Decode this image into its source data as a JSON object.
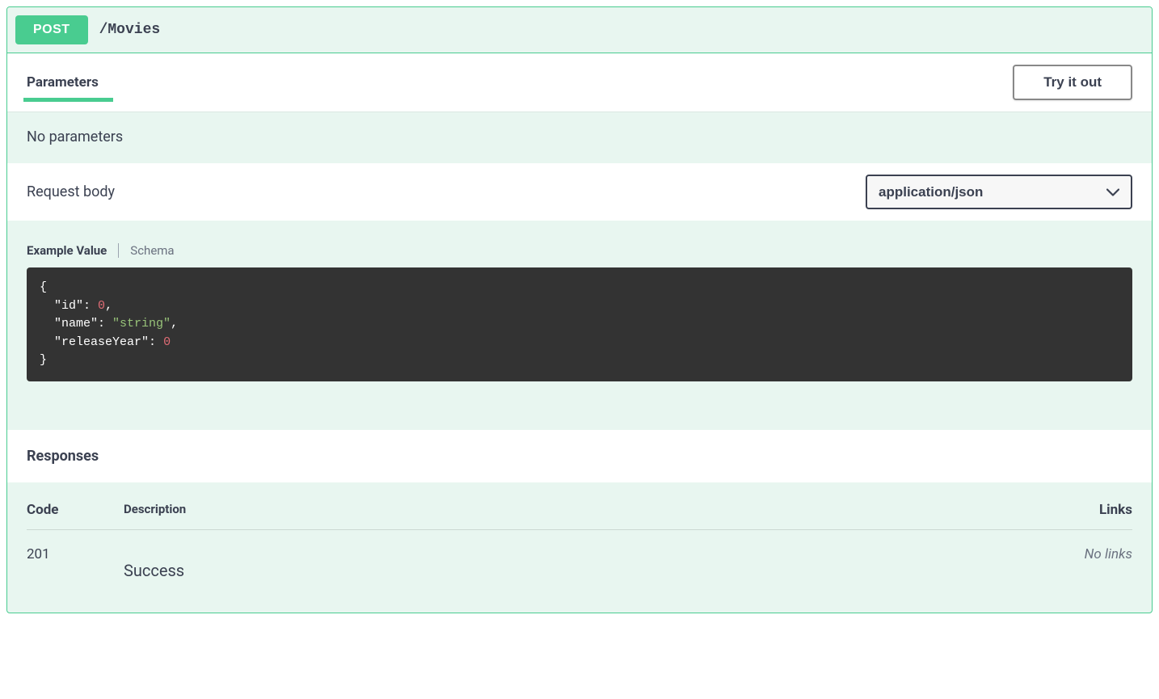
{
  "method": "POST",
  "path": "/Movies",
  "parameters": {
    "tab_label": "Parameters",
    "try_label": "Try it out",
    "empty_text": "No parameters"
  },
  "request_body": {
    "label": "Request body",
    "content_type": "application/json",
    "tabs": {
      "example": "Example Value",
      "schema": "Schema"
    },
    "example_json": {
      "id": 0,
      "name": "string",
      "releaseYear": 0
    }
  },
  "responses": {
    "heading": "Responses",
    "columns": {
      "code": "Code",
      "description": "Description",
      "links": "Links"
    },
    "rows": [
      {
        "code": "201",
        "description": "Success",
        "links": "No links"
      }
    ]
  }
}
